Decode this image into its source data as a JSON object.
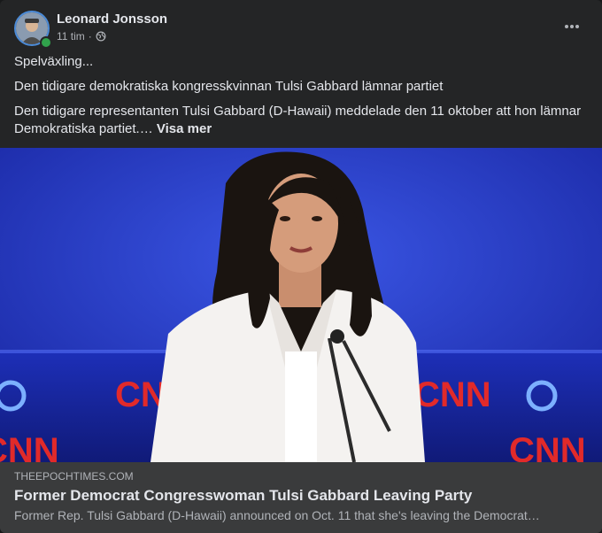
{
  "post": {
    "author": "Leonard Jonsson",
    "time": "11 tim",
    "separator": "·",
    "paragraphs": [
      "Spelväxling...",
      "Den tidigare demokratiska kongresskvinnan Tulsi Gabbard lämnar partiet",
      "Den tidigare representanten Tulsi Gabbard (D-Hawaii) meddelade den 11 oktober att hon lämnar Demokratiska partiet.…"
    ],
    "see_more": "Visa mer",
    "more_icon": "ellipsis-icon",
    "privacy_icon": "globe-icon"
  },
  "image": {
    "logos": [
      "CNN",
      "CNN",
      "CNN",
      "CNN"
    ]
  },
  "link": {
    "domain": "THEEPOCHTIMES.COM",
    "title": "Former Democrat Congresswoman Tulsi Gabbard Leaving Party",
    "description": "Former Rep. Tulsi Gabbard (D-Hawaii) announced on Oct. 11 that she's leaving the Democrat…"
  },
  "colors": {
    "card": "#242526",
    "link_bar": "#3a3b3c",
    "online": "#31a24c",
    "stage_blue": "#2136c4",
    "logo_red": "#e12a2a"
  }
}
